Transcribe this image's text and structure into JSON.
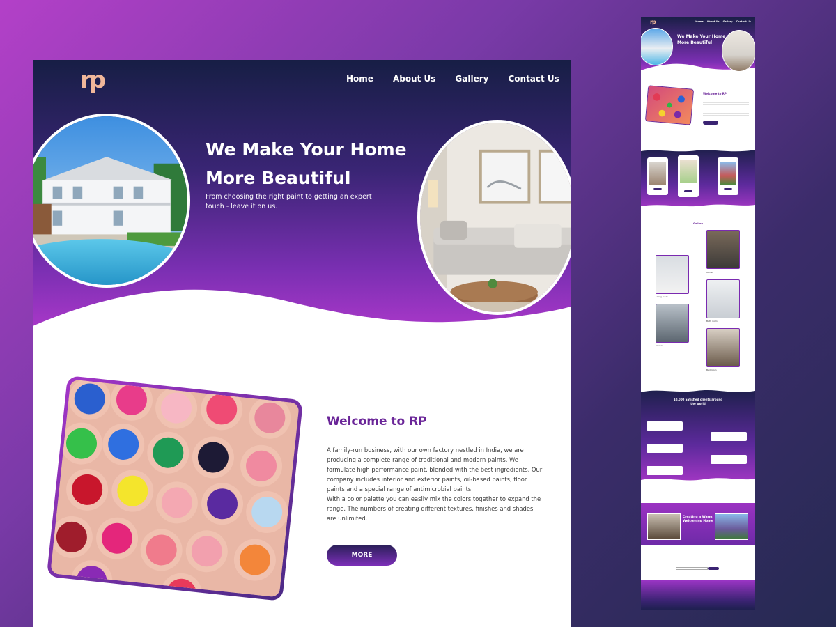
{
  "brand": {
    "logo_text": "rp"
  },
  "nav": {
    "items": [
      "Home",
      "About Us",
      "Gallery",
      "Contact Us"
    ]
  },
  "hero": {
    "title_line1": "We Make Your Home",
    "title_line2": "More Beautiful",
    "subtitle": "From choosing the right paint to getting an expert touch - leave it on us."
  },
  "welcome": {
    "title": "Welcome to RP",
    "paragraph1": "A family-run business, with our own factory nestled in India, we are producing a complete range of traditional and modern paints. We formulate high performance paint, blended with the best ingredients. Our company includes interior and exterior paints, oil-based paints, floor paints and a special range of antimicrobial paints.",
    "paragraph2": "With a color palette you can easily mix the colors together to expand the range. The numbers of creating different textures, finishes and shades are unlimited.",
    "button": "MORE"
  },
  "preview": {
    "logo_text": "rp",
    "nav": [
      "Home",
      "About Us",
      "Gallery",
      "Contact Us"
    ],
    "hero_title": "We Make Your Home More Beautiful",
    "welcome_title": "Welcome to RP",
    "cards": [
      "Exterior",
      "Interior",
      "Exterior"
    ],
    "gallery_title": "Gallery",
    "gallery_captions": [
      "Living room",
      "Office",
      "Kitchen",
      "Bath room",
      "Bed room"
    ],
    "testimonials_title": "10,000 Satisfied clients around the world",
    "promo_title": "Creating a Warm, Welcoming Home"
  },
  "colors": {
    "accent_purple": "#6a2598",
    "hero_top": "#171e45",
    "hero_bottom": "#b039cc",
    "logo_peach": "#f0b79a"
  }
}
